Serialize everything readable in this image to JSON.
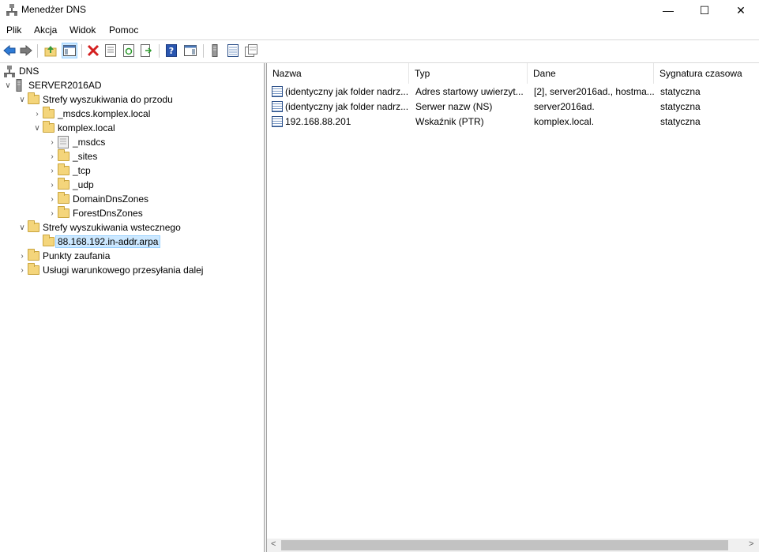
{
  "window": {
    "title": "Menedżer DNS",
    "minimize": "—",
    "maximize": "☐",
    "close": "✕"
  },
  "menu": {
    "file": "Plik",
    "action": "Akcja",
    "view": "Widok",
    "help": "Pomoc"
  },
  "tree": {
    "root": "DNS",
    "server": "SERVER2016AD",
    "forward_zones": "Strefy wyszukiwania do przodu",
    "msdcs_zone": "_msdcs.komplex.local",
    "komplex_zone": "komplex.local",
    "sub_msdcs": "_msdcs",
    "sub_sites": "_sites",
    "sub_tcp": "_tcp",
    "sub_udp": "_udp",
    "sub_domaindns": "DomainDnsZones",
    "sub_forestdns": "ForestDnsZones",
    "reverse_zones": "Strefy wyszukiwania wstecznego",
    "reverse_zone_selected": "88.168.192.in-addr.arpa",
    "trust_points": "Punkty zaufania",
    "conditional_forwarders": "Usługi warunkowego przesyłania dalej"
  },
  "list": {
    "columns": [
      "Nazwa",
      "Typ",
      "Dane",
      "Sygnatura czasowa"
    ],
    "rows": [
      {
        "name": "(identyczny jak folder nadrz...",
        "type": "Adres startowy uwierzyt...",
        "data": "[2], server2016ad., hostma...",
        "timestamp": "statyczna"
      },
      {
        "name": "(identyczny jak folder nadrz...",
        "type": "Serwer nazw (NS)",
        "data": "server2016ad.",
        "timestamp": "statyczna"
      },
      {
        "name": "192.168.88.201",
        "type": "Wskaźnik (PTR)",
        "data": "komplex.local.",
        "timestamp": "statyczna"
      }
    ]
  },
  "scrollbar": {
    "left_arrow": "<",
    "right_arrow": ">"
  }
}
